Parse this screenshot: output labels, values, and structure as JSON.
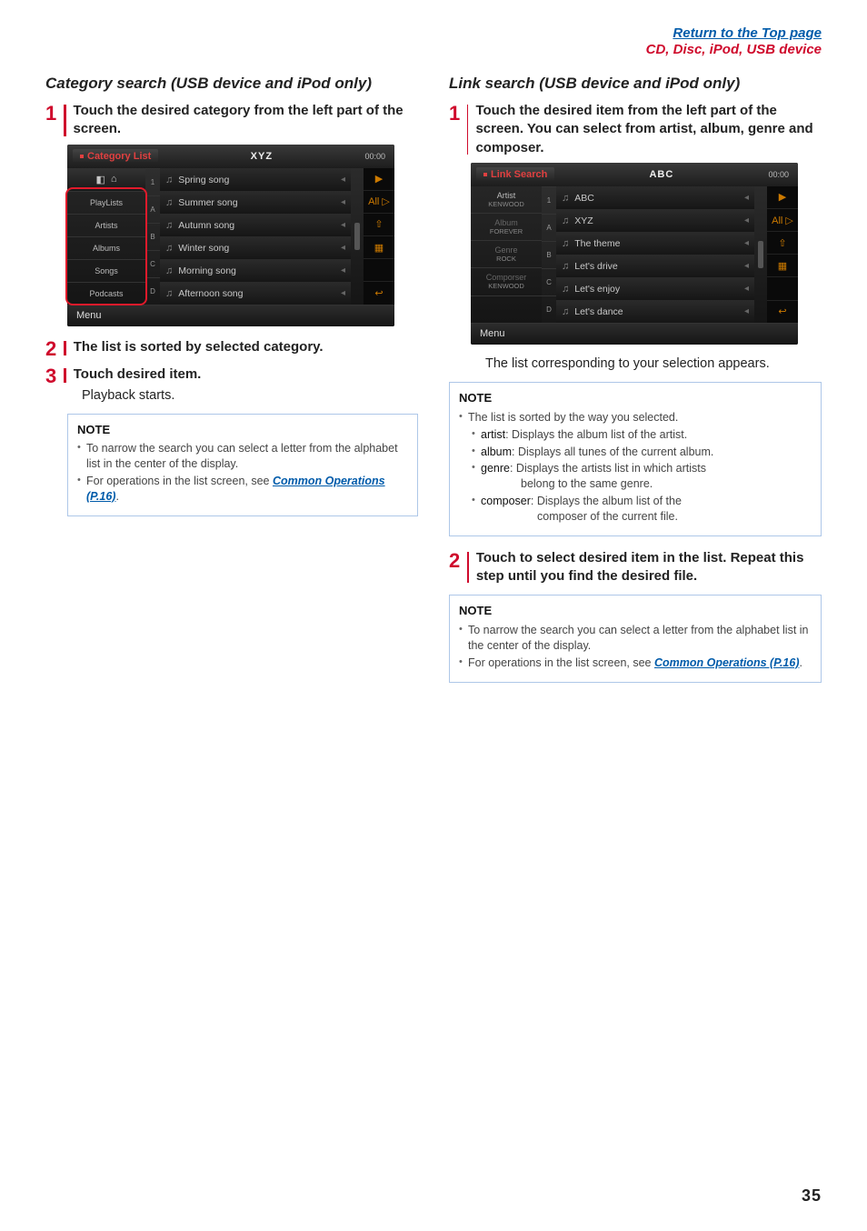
{
  "header": {
    "top_link": "Return to the Top page",
    "sub_link": "CD, Disc, iPod, USB device"
  },
  "left": {
    "heading": "Category search (USB device and iPod only)",
    "step1": {
      "num": "1",
      "text": "Touch the desired category from the left part of the screen."
    },
    "screenshot": {
      "tab": "Category List",
      "title": "XYZ",
      "clock": "00:00",
      "categories": [
        "PlayLists",
        "Artists",
        "Albums",
        "Songs",
        "Podcasts"
      ],
      "alpha": [
        "1",
        "A",
        "B",
        "C",
        "D"
      ],
      "rows": [
        "Spring song",
        "Summer song",
        "Autumn song",
        "Winter song",
        "Morning song",
        "Afternoon song"
      ],
      "side_all": "All ▷",
      "menu": "Menu"
    },
    "step2": {
      "num": "2",
      "text": "The list is sorted by selected category."
    },
    "step3": {
      "num": "3",
      "text": "Touch desired item."
    },
    "step3_body": "Playback starts.",
    "note": {
      "hd": "NOTE",
      "b1": "To narrow the search you can select a letter from the alphabet list in the center of the display.",
      "b2a": "For operations in the list screen, see ",
      "b2_link": "Common Operations (P.16)",
      "b2b": "."
    }
  },
  "right": {
    "heading": "Link search (USB device and iPod only)",
    "step1": {
      "num": "1",
      "text": "Touch the desired item from the left part of the screen. You can select from artist, album, genre and composer."
    },
    "screenshot": {
      "tab": "Link Search",
      "title": "ABC",
      "clock": "00:00",
      "left_items": [
        {
          "label": "Artist",
          "sub": "KENWOOD"
        },
        {
          "label": "Album",
          "sub": "FOREVER"
        },
        {
          "label": "Genre",
          "sub": "ROCK"
        },
        {
          "label": "Comporser",
          "sub": "KENWOOD"
        }
      ],
      "alpha": [
        "1",
        "A",
        "B",
        "C",
        "D"
      ],
      "rows": [
        "ABC",
        "XYZ",
        "The theme",
        "Let's drive",
        "Let's enjoy",
        "Let's dance"
      ],
      "side_all": "All ▷",
      "menu": "Menu"
    },
    "step1_body": "The list corresponding to your selection appears.",
    "note1": {
      "hd": "NOTE",
      "intro": "The list is sorted by the way you selected.",
      "artist_t": "artist",
      "artist_b": ": Displays the album list of the artist.",
      "album_t": "album",
      "album_b": ": Displays all tunes of the current album.",
      "genre_t": "genre",
      "genre_b": ": Displays the artists list in which artists",
      "genre_c": "belong to the same genre.",
      "composer_t": "composer",
      "composer_b": ": Displays the album list of the",
      "composer_c": "composer of the current file."
    },
    "step2": {
      "num": "2",
      "text": "Touch to select desired item in the list. Repeat this step until you find the desired file."
    },
    "note2": {
      "hd": "NOTE",
      "b1": "To narrow the search you can select a letter from the alphabet list in the center of the display.",
      "b2a": "For operations in the list screen, see ",
      "b2_link": "Common Operations (P.16)",
      "b2b": "."
    }
  },
  "page_num": "35"
}
